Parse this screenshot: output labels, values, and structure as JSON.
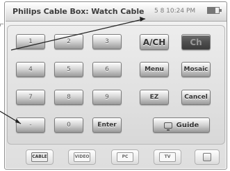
{
  "window": {
    "title": "Philips Cable Box: Watch Cable",
    "status": "5 8   10:24 PM"
  },
  "keypad": {
    "numbers": [
      "1",
      "2",
      "3",
      "4",
      "5",
      "6",
      "7",
      "8",
      "9",
      "-",
      "0"
    ],
    "enter_label": "Enter"
  },
  "controls": {
    "ach_label": "A/CH",
    "ch_label": "Ch",
    "menu_label": "Menu",
    "mosaic_label": "Mosaic",
    "ez_label": "EZ",
    "cancel_label": "Cancel",
    "guide_label": "Guide"
  },
  "bottombar": {
    "tabs": [
      "CABLE",
      "VIDEO",
      "PC",
      "TV"
    ]
  },
  "icons": {
    "battery": "battery-icon",
    "guide": "tv-icon",
    "help": "help-icon"
  },
  "colors": {
    "button_dark": "#4f4f4f",
    "button_light": "#d4d4d4",
    "frame": "#8f8f8f",
    "callout": "#333333"
  }
}
